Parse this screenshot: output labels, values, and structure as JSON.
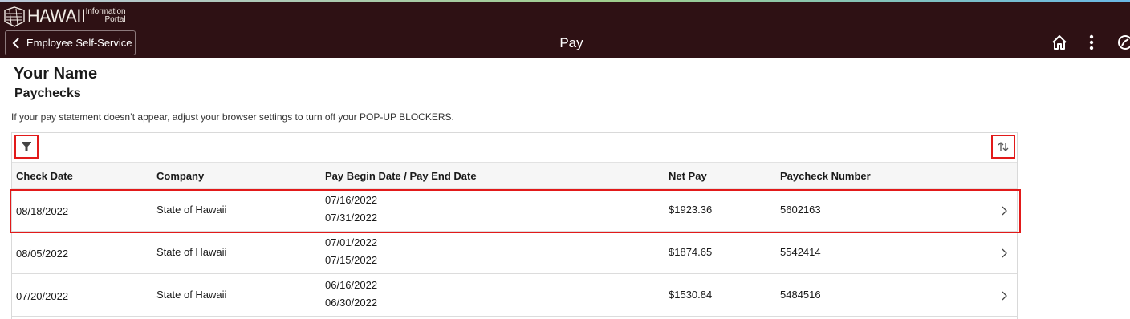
{
  "header": {
    "logo_word": "HAWAII",
    "logo_sub_1": "Information",
    "logo_sub_2": "Portal",
    "back_label": "Employee Self-Service",
    "title": "Pay",
    "icons": [
      "home-icon",
      "more-vertical-icon",
      "navbar-compass-icon"
    ]
  },
  "page": {
    "user_name": "Your Name",
    "section_title": "Paychecks",
    "notice": "If your pay statement doesn’t appear, adjust your browser settings to turn off your POP-UP BLOCKERS."
  },
  "toolbar": {
    "filter_icon": "filter-icon",
    "sort_icon": "sort-icon"
  },
  "table": {
    "columns": [
      "Check Date",
      "Company",
      "Pay Begin Date / Pay End Date",
      "Net Pay",
      "Paycheck Number"
    ],
    "rows": [
      {
        "check_date": "08/18/2022",
        "company": "State of Hawaii",
        "begin": "07/16/2022",
        "end": "07/31/2022",
        "net_pay": "$1923.36",
        "number": "5602163"
      },
      {
        "check_date": "08/05/2022",
        "company": "State of Hawaii",
        "begin": "07/01/2022",
        "end": "07/15/2022",
        "net_pay": "$1874.65",
        "number": "5542414"
      },
      {
        "check_date": "07/20/2022",
        "company": "State of Hawaii",
        "begin": "06/16/2022",
        "end": "06/30/2022",
        "net_pay": "$1530.84",
        "number": "5484516"
      }
    ]
  },
  "colors": {
    "header_bg": "#2e1114",
    "highlight": "#e21a1a"
  }
}
